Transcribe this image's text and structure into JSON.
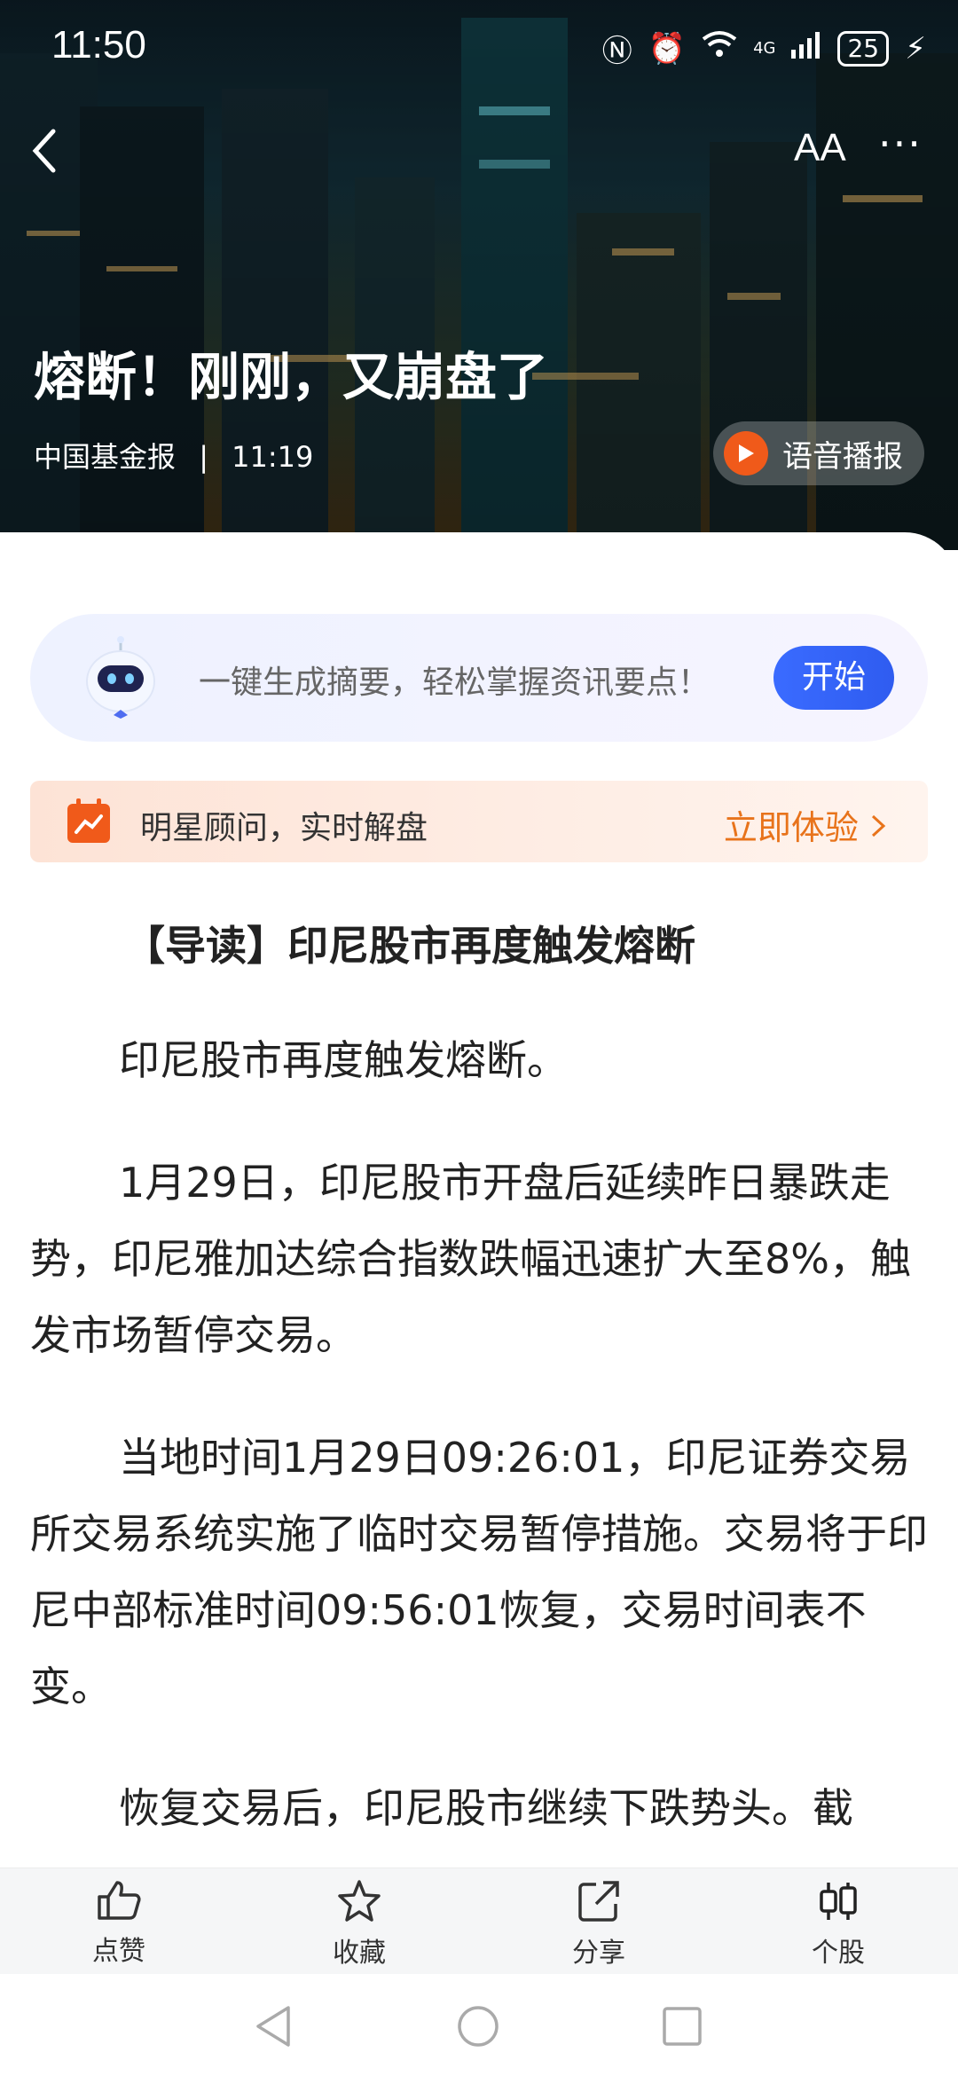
{
  "status_bar": {
    "time": "11:50",
    "network": "4G",
    "battery": "25"
  },
  "header": {
    "font_size_label": "AA",
    "more_label": "···"
  },
  "article": {
    "title": "熔断！刚刚，又崩盘了",
    "source": "中国基金报",
    "publish_time": "11:19",
    "separator": "|",
    "voice_label": "语音播报"
  },
  "ai_summary": {
    "text": "一键生成摘要，轻松掌握资讯要点！",
    "button_label": "开始"
  },
  "star_advisor": {
    "text": "明星顾问，实时解盘",
    "link_label": "立即体验"
  },
  "body": {
    "guide": "【导读】印尼股市再度触发熔断",
    "paragraphs": [
      "印尼股市再度触发熔断。",
      "1月29日，印尼股市开盘后延续昨日暴跌走势，印尼雅加达综合指数跌幅迅速扩大至8%，触发市场暂停交易。",
      "当地时间1月29日09:26:01，印尼证券交易所交易系统实施了临时交易暂停措施。交易将于印尼中部标准时间09:56:01恢复，交易时间表不变。",
      "恢复交易后，印尼股市继续下跌势头。截"
    ]
  },
  "bottom_actions": [
    {
      "label": "点赞",
      "icon": "thumbs-up-icon"
    },
    {
      "label": "收藏",
      "icon": "star-icon"
    },
    {
      "label": "分享",
      "icon": "share-icon"
    },
    {
      "label": "个股",
      "icon": "candlestick-icon"
    }
  ],
  "colors": {
    "accent_blue": "#2f5cf0",
    "accent_orange": "#e8731b",
    "play_orange": "#f05a1a"
  }
}
